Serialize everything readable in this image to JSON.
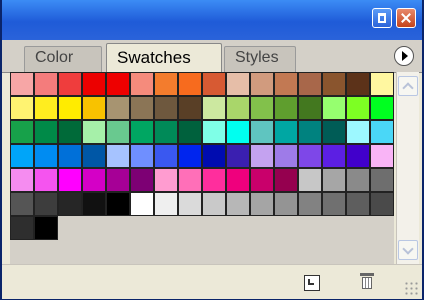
{
  "panel": {
    "tabs": [
      {
        "label": "Color"
      },
      {
        "label": "Swatches"
      },
      {
        "label": "Styles"
      }
    ]
  },
  "swatches": [
    [
      "#F7A6A6",
      "#F47C7C",
      "#EF3D3D",
      "#EC0000",
      "#EE0000",
      "#F58B7C",
      "#F37C2D",
      "#F76B1E",
      "#D75A33",
      "#E6BEA8",
      "#D19B7E",
      "#C27953",
      "#A8674A",
      "#8A552E"
    ],
    [
      "#5C3219",
      "#FFF7A0",
      "#FFF371",
      "#FFED1F",
      "#FFEC00",
      "#F8C200",
      "#A79471",
      "#8B7556",
      "#6E583E",
      "#593F26",
      "#CCE8A0",
      "#A9D66A",
      "#82C14B",
      "#5F9E2E"
    ],
    [
      "#43781F",
      "#96FF6F",
      "#7DFF23",
      "#00FF20",
      "#17A14A",
      "#008A48",
      "#006A39",
      "#A6F0A9",
      "#69C98F",
      "#00A662",
      "#008A58",
      "#00613D",
      "#7FFFE7",
      "#00FFF0"
    ],
    [
      "#5FC5C0",
      "#00A7A3",
      "#00827F",
      "#005C56",
      "#9DF8FF",
      "#4AD7F7",
      "#00A5F9",
      "#008CF2",
      "#0070D9",
      "#0057A6",
      "#A6C3FF",
      "#6F8FFF",
      "#3A58F0",
      "#0025EE"
    ],
    [
      "#000CB0",
      "#3A1FB0",
      "#C4A2F0",
      "#9E7BE8",
      "#7E47E8",
      "#5C1FE3",
      "#4100CB",
      "#F9B4F6",
      "#F58CF0",
      "#F554EF",
      "#FF00FF",
      "#D400C6",
      "#A60096",
      "#7D0074"
    ],
    [
      "#FF9CD0",
      "#FF6FB8",
      "#FF2E9D",
      "#EF007D",
      "#C9006B",
      "#95004F",
      "#C7C7C7",
      "#A6A6A6",
      "#8A8A8A",
      "#6E6E6E",
      "#555555",
      "#3D3D3D",
      "#262626",
      "#111111"
    ],
    [
      "#000000",
      "#FFFFFF",
      "#EFEFEF",
      "#DADADA",
      "#C9C9C9",
      "#B7B7B7",
      "#A5A5A5",
      "#949494",
      "#828282",
      "#707070",
      "#5E5E5E",
      "#4A4A4A",
      "#2E2E2E",
      "#000000"
    ]
  ],
  "scrollbar": {
    "up": "up-arrow",
    "down": "down-arrow"
  },
  "footer": {
    "new_icon": "new-swatch-icon",
    "trash_icon": "trash-icon"
  }
}
